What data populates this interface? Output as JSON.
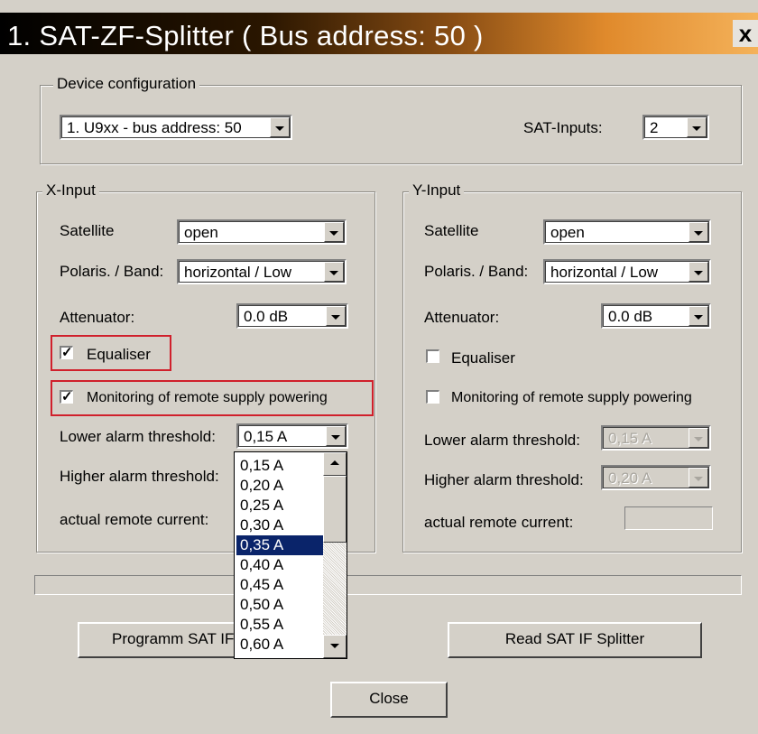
{
  "window": {
    "title": "1. SAT-ZF-Splitter ( Bus address: 50 )",
    "close_glyph": "x"
  },
  "device_config": {
    "legend": "Device configuration",
    "device_value": "1. U9xx - bus address: 50",
    "sat_inputs_label": "SAT-Inputs:",
    "sat_inputs_value": "2"
  },
  "x_input": {
    "legend": "X-Input",
    "satellite_label": "Satellite",
    "satellite_value": "open",
    "polaris_label": "Polaris. / Band:",
    "polaris_value": "horizontal / Low",
    "attenuator_label": "Attenuator:",
    "attenuator_value": "0.0 dB",
    "equaliser_label": "Equaliser",
    "equaliser_checked": true,
    "monitoring_label": "Monitoring of remote supply powering",
    "monitoring_checked": true,
    "lower_label": "Lower alarm threshold:",
    "lower_value": "0,15 A",
    "higher_label": "Higher alarm threshold:",
    "current_label": "actual remote current:"
  },
  "y_input": {
    "legend": "Y-Input",
    "satellite_label": "Satellite",
    "satellite_value": "open",
    "polaris_label": "Polaris. / Band:",
    "polaris_value": "horizontal / Low",
    "attenuator_label": "Attenuator:",
    "attenuator_value": "0.0 dB",
    "equaliser_label": "Equaliser",
    "equaliser_checked": false,
    "monitoring_label": "Monitoring of remote supply powering",
    "monitoring_checked": false,
    "lower_label": "Lower alarm threshold:",
    "lower_value": "0,15 A",
    "higher_label": "Higher alarm threshold:",
    "higher_value": "0,20 A",
    "current_label": "actual remote current:"
  },
  "dropdown_list": {
    "items": [
      "0,15 A",
      "0,20 A",
      "0,25 A",
      "0,30 A",
      "0,35 A",
      "0,40 A",
      "0,45 A",
      "0,50 A",
      "0,55 A",
      "0,60 A"
    ],
    "selected_index": 4
  },
  "buttons": {
    "programm": "Programm SAT IF Splitter",
    "read": "Read SAT IF Splitter",
    "close": "Close"
  },
  "colors": {
    "selection": "#0a246a",
    "highlight_frame": "#d0202c"
  }
}
